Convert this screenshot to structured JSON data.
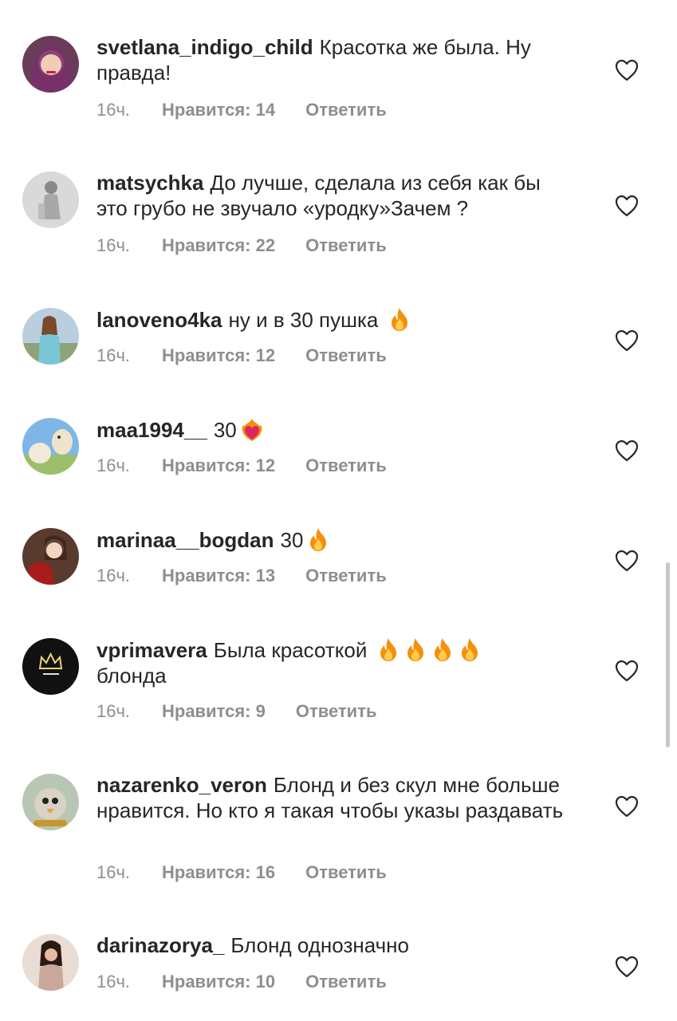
{
  "comments": [
    {
      "user": "svetlana_indigo_child",
      "text": "Красотка же была. Ну правда!",
      "emoji": "",
      "time": "16ч.",
      "likes": "Нравится: 14",
      "reply": "Ответить",
      "avatar": "avatar-woman-headscarf"
    },
    {
      "user": "matsychka",
      "text": "До лучше, сделала из себя как бы это грубо не звучало «уродку»Зачем ?",
      "emoji": "",
      "time": "16ч.",
      "likes": "Нравится: 22",
      "reply": "Ответить",
      "avatar": "avatar-bw-figure"
    },
    {
      "user": "lanoveno4ka",
      "text": "ну и в 30 пушка",
      "emoji": "🔥",
      "time": "16ч.",
      "likes": "Нравится: 12",
      "reply": "Ответить",
      "avatar": "avatar-woman-outdoors"
    },
    {
      "user": "maa1994__",
      "text": "30",
      "emoji": "❤️‍🔥",
      "time": "16ч.",
      "likes": "Нравится: 12",
      "reply": "Ответить",
      "avatar": "avatar-alpacas"
    },
    {
      "user": "marinaa__bogdan",
      "text": "30",
      "emoji": "🔥",
      "time": "16ч.",
      "likes": "Нравится: 13",
      "reply": "Ответить",
      "avatar": "avatar-woman-red"
    },
    {
      "user": "vprimavera",
      "text": "Была красоткой",
      "emoji": "🔥🔥🔥🔥",
      "text2": "блонда",
      "time": "16ч.",
      "likes": "Нравится: 9",
      "reply": "Ответить",
      "avatar": "avatar-crown-logo"
    },
    {
      "user": "nazarenko_veron",
      "text": "Блонд и без скул мне больше нравится. Но кто я такая чтобы указы раздавать",
      "emoji": "",
      "time": "16ч.",
      "likes": "Нравится: 16",
      "reply": "Ответить",
      "avatar": "avatar-cartoon-bird"
    },
    {
      "user": "darinazorya_",
      "text": "Блонд однозначно",
      "emoji": "",
      "time": "16ч.",
      "likes": "Нравится: 10",
      "reply": "Ответить",
      "avatar": "avatar-woman-dark"
    }
  ],
  "colors": {
    "text": "#262626",
    "secondary": "#8e8e8e",
    "flame": "#f4900c",
    "heart_fire": "#e0245e"
  },
  "icons": {
    "like": "heart-outline-icon",
    "flame": "fire-emoji",
    "heart_fire": "heart-on-fire-emoji"
  }
}
